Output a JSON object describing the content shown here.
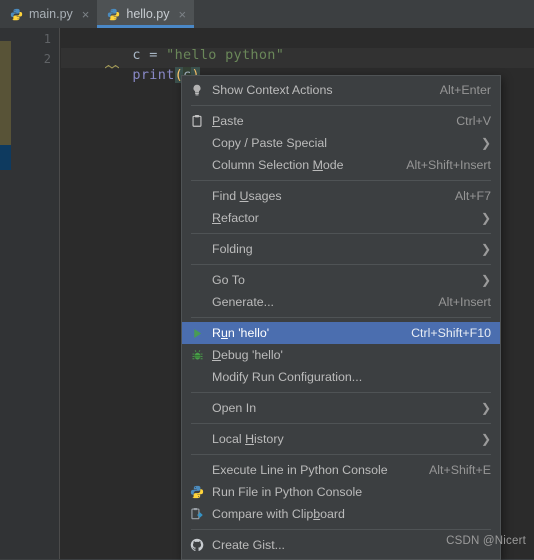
{
  "window": {
    "app": "PyCharm Editor",
    "colors": {
      "editor_bg": "#2b2b2b",
      "chrome_bg": "#3c3f41",
      "gutter_bg": "#313335",
      "menu_bg": "#3c3f41",
      "menu_border": "#4f5355",
      "selection_blue": "#4b6eaf",
      "tab_active_underline": "#4a88c7",
      "string_green": "#6a8759",
      "default_text": "#a9b7c6",
      "function_blue": "#8888c6",
      "bracket_gold": "#ffc66d",
      "marker_olive": "#585337",
      "marker_blue": "#0e3a5f"
    }
  },
  "tabs": [
    {
      "label": "main.py",
      "icon": "python-file-icon",
      "active": false,
      "close": "×"
    },
    {
      "label": "hello.py",
      "icon": "python-file-icon",
      "active": true,
      "close": "×"
    }
  ],
  "editor": {
    "line_numbers": [
      "1",
      "2"
    ],
    "lines": [
      {
        "number": "1",
        "tokens": [
          {
            "text": "c = ",
            "style": "default"
          },
          {
            "text": "\"hello python\"",
            "style": "string"
          }
        ]
      },
      {
        "number": "2",
        "tokens": [
          {
            "text": "print",
            "style": "function"
          },
          {
            "text": "(",
            "style": "bracket"
          },
          {
            "text": "c",
            "style": "variable"
          },
          {
            "text": ")",
            "style": "bracket"
          }
        ]
      }
    ]
  },
  "context_menu": {
    "groups": [
      {
        "items": [
          {
            "label": "Show Context Actions",
            "accel": "Alt+Enter",
            "icon": "lightbulb-icon",
            "submenu": false,
            "selected": false,
            "mnemonic": ""
          }
        ]
      },
      {
        "items": [
          {
            "label": "Paste",
            "accel": "Ctrl+V",
            "icon": "clipboard-icon",
            "submenu": false,
            "selected": false,
            "mnemonic": "P"
          },
          {
            "label": "Copy / Paste Special",
            "accel": "",
            "icon": "",
            "submenu": true,
            "selected": false,
            "mnemonic": ""
          },
          {
            "label": "Column Selection Mode",
            "accel": "Alt+Shift+Insert",
            "icon": "",
            "submenu": false,
            "selected": false,
            "mnemonic": "M"
          }
        ]
      },
      {
        "items": [
          {
            "label": "Find Usages",
            "accel": "Alt+F7",
            "icon": "",
            "submenu": false,
            "selected": false,
            "mnemonic": "U"
          },
          {
            "label": "Refactor",
            "accel": "",
            "icon": "",
            "submenu": true,
            "selected": false,
            "mnemonic": "R"
          }
        ]
      },
      {
        "items": [
          {
            "label": "Folding",
            "accel": "",
            "icon": "",
            "submenu": true,
            "selected": false,
            "mnemonic": ""
          }
        ]
      },
      {
        "items": [
          {
            "label": "Go To",
            "accel": "",
            "icon": "",
            "submenu": true,
            "selected": false,
            "mnemonic": ""
          },
          {
            "label": "Generate...",
            "accel": "Alt+Insert",
            "icon": "",
            "submenu": false,
            "selected": false,
            "mnemonic": ""
          }
        ]
      },
      {
        "items": [
          {
            "label": "Run 'hello'",
            "accel": "Ctrl+Shift+F10",
            "icon": "run-play-icon",
            "submenu": false,
            "selected": true,
            "mnemonic": "u"
          },
          {
            "label": "Debug 'hello'",
            "accel": "",
            "icon": "debug-bug-icon",
            "submenu": false,
            "selected": false,
            "mnemonic": "D"
          },
          {
            "label": "Modify Run Configuration...",
            "accel": "",
            "icon": "",
            "submenu": false,
            "selected": false,
            "mnemonic": ""
          }
        ]
      },
      {
        "items": [
          {
            "label": "Open In",
            "accel": "",
            "icon": "",
            "submenu": true,
            "selected": false,
            "mnemonic": ""
          }
        ]
      },
      {
        "items": [
          {
            "label": "Local History",
            "accel": "",
            "icon": "",
            "submenu": true,
            "selected": false,
            "mnemonic": "H"
          }
        ]
      },
      {
        "items": [
          {
            "label": "Execute Line in Python Console",
            "accel": "Alt+Shift+E",
            "icon": "",
            "submenu": false,
            "selected": false,
            "mnemonic": ""
          },
          {
            "label": "Run File in Python Console",
            "accel": "",
            "icon": "python-logo-icon",
            "submenu": false,
            "selected": false,
            "mnemonic": ""
          },
          {
            "label": "Compare with Clipboard",
            "accel": "",
            "icon": "compare-clipboard-icon",
            "submenu": false,
            "selected": false,
            "mnemonic": "b"
          }
        ]
      },
      {
        "items": [
          {
            "label": "Create Gist...",
            "accel": "",
            "icon": "github-icon",
            "submenu": false,
            "selected": false,
            "mnemonic": ""
          }
        ]
      }
    ]
  },
  "watermark": {
    "text": "CSDN @Nicert"
  }
}
